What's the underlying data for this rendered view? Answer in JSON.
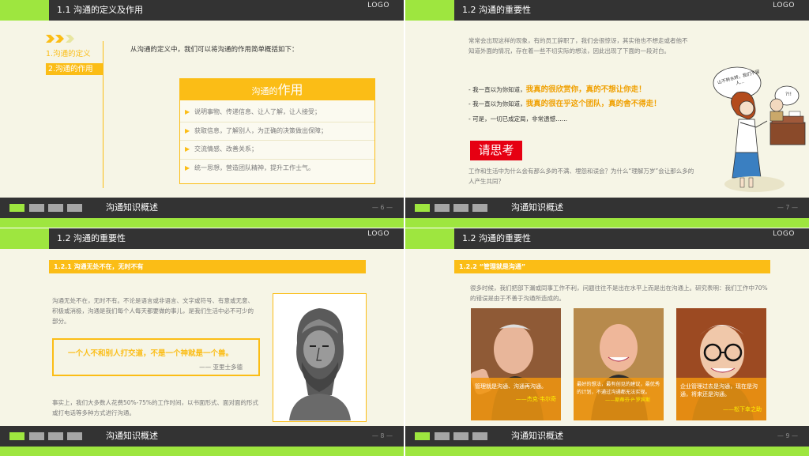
{
  "logo_text": "LOGO",
  "footer_title": "沟通知识概述",
  "colors": {
    "green": "#9ee63f",
    "dark": "#333333",
    "orange": "#fbbd16",
    "red": "#e60012",
    "bg": "#f6f5e6"
  },
  "slide1": {
    "title": "1.1 沟通的定义及作用",
    "nav": [
      "1.沟通的定义",
      "2.沟通的作用"
    ],
    "intro": "从沟通的定义中，我们可以将沟通的作用简单概括如下：",
    "box_title_small": "沟通的",
    "box_title_big": "作用",
    "items": [
      "说明事物、传递信息、让人了解，让人接受；",
      "获取信息，了解别人，为正确的决策做出保障；",
      "交流情感、改善关系；",
      "统一思想，营造团队精神，提升工作士气。"
    ],
    "page": "— 6 —"
  },
  "slide2": {
    "title": "1.2 沟通的重要性",
    "para": "常常会出现这样的现象，有的员工辞职了，我们会很惊讶，其实他也不想走或者他不知道外面的情况，存在着一些不切实际的想法，因此出现了下面的一段对白。",
    "line1_prefix": "- 我一直以为你知道，",
    "line1_emph": "我真的很欣赏你，真的不想让你走！",
    "line2_prefix": "- 我一直以为你知道，",
    "line2_emph": "我真的很在乎这个团队，真的舍不得走！",
    "line3": "- 可是，一切已成定局，非常遗憾……",
    "think": "请思考",
    "question": "工作和生活中为什么会有那么多的不满、埋怨和误会？为什么“理解万岁”会让那么多的人产生共同？",
    "bubble1": "山不转水转，我们不留人…",
    "bubble2": "?!!",
    "page": "— 7 —"
  },
  "slide3": {
    "title": "1.2 沟通的重要性",
    "section": "1.2.1  沟通无处不在，无时不有",
    "para1": "沟通无处不在，无时不有。不论是语言或非语言、文字或符号、有意或无意、积极或消极，沟通是我们每个人每天都要做的事儿，是我们生活中必不可少的部分。",
    "quote": "一个人不和别人打交道，不是一个神就是一个兽。",
    "quote_author": "—— 亚里士多德",
    "para2": "事实上，我们大多数人花费50%-75%的工作时间，以书面形式、面对面的形式或打电话等多种方式进行沟通。",
    "page": "— 8 —"
  },
  "slide4": {
    "title": "1.2 沟通的重要性",
    "section": "1.2.2  “管理就是沟通”",
    "para": "很多时候，我们把部下漏或同事工作不利，问题往往不是出在水平上而是出在沟通上。研究表明：我们工作中70%的错误是由于不善于沟通所造成的。",
    "cards": [
      {
        "text": "管理就是沟通、沟通再沟通。",
        "author": "——杰克·韦尔奇"
      },
      {
        "text": "最好的想法，最有创见的建议，最优秀的计划，不通过沟通都无法实现。",
        "author": "——斯蒂芬·P·罗宾斯"
      },
      {
        "text": "企业管理过去是沟通，现在是沟通，将来还是沟通。",
        "author": "——松下幸之助"
      }
    ],
    "page": "— 9 —"
  }
}
